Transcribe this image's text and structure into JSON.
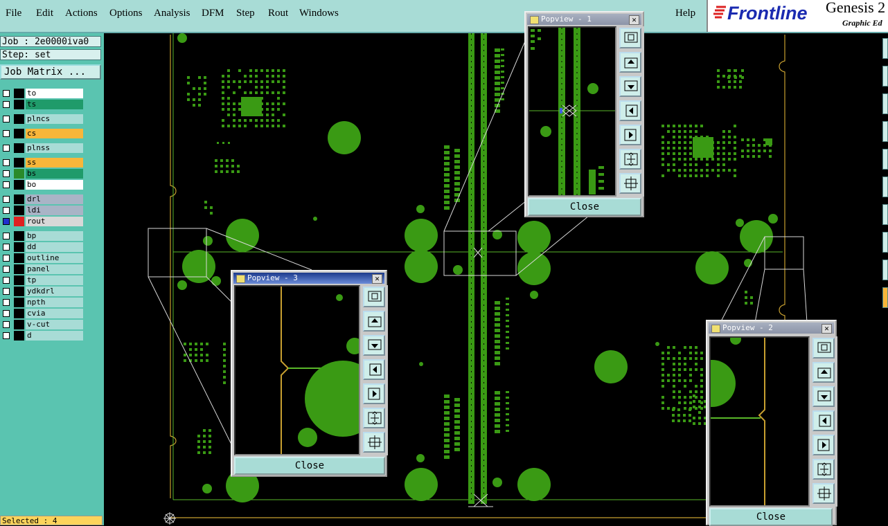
{
  "menu": {
    "file": "File",
    "edit": "Edit",
    "actions": "Actions",
    "options": "Options",
    "analysis": "Analysis",
    "dfm": "DFM",
    "step": "Step",
    "rout": "Rout",
    "windows": "Windows",
    "help": "Help"
  },
  "brand": {
    "logo": "Frontline",
    "title": "Genesis 2",
    "subtitle": "Graphic Ed"
  },
  "job": {
    "job_line": "Job : 2e0000iva0",
    "step_line": "Step: set",
    "matrix_button": "Job Matrix ..."
  },
  "layers": [
    {
      "name": "to",
      "color": "#ffffff",
      "icon_color": "#000000"
    },
    {
      "name": "ts",
      "color": "#1f9b6a",
      "icon_color": "#000000"
    },
    {
      "name": "plncs",
      "color": "#a8dcd6",
      "icon_color": "#000000"
    },
    {
      "name": "cs",
      "color": "#f8b63a",
      "icon_color": "#000000"
    },
    {
      "name": "plnss",
      "color": "#a8dcd6",
      "icon_color": "#000000"
    },
    {
      "name": "ss",
      "color": "#f8b63a",
      "icon_color": "#000000"
    },
    {
      "name": "bs",
      "color": "#1f9b6a",
      "icon_color": "#2a8a2a"
    },
    {
      "name": "bo",
      "color": "#ffffff",
      "icon_color": "#000000"
    },
    {
      "name": "drl",
      "color": "#a9b4c6",
      "icon_color": "#000000"
    },
    {
      "name": "ldi",
      "color": "#a9b4c6",
      "icon_color": "#000000"
    },
    {
      "name": "rout",
      "color": "#d8d8d8",
      "icon_color": "#e02020"
    },
    {
      "name": "bp",
      "color": "#a8dcd6",
      "icon_color": "#000000"
    },
    {
      "name": "dd",
      "color": "#a8dcd6",
      "icon_color": "#000000"
    },
    {
      "name": "outline",
      "color": "#a8dcd6",
      "icon_color": "#000000"
    },
    {
      "name": "panel",
      "color": "#a8dcd6",
      "icon_color": "#000000"
    },
    {
      "name": "tp",
      "color": "#a8dcd6",
      "icon_color": "#000000"
    },
    {
      "name": "ydkdrl",
      "color": "#a8dcd6",
      "icon_color": "#000000"
    },
    {
      "name": "npth",
      "color": "#a8dcd6",
      "icon_color": "#000000"
    },
    {
      "name": "cvia",
      "color": "#a8dcd6",
      "icon_color": "#000000"
    },
    {
      "name": "v-cut",
      "color": "#a8dcd6",
      "icon_color": "#000000"
    },
    {
      "name": "d",
      "color": "#a8dcd6",
      "icon_color": "#000000"
    }
  ],
  "status": {
    "selected": "Selected : 4"
  },
  "popviews": [
    {
      "title": "Popview - 1",
      "close": "Close"
    },
    {
      "title": "Popview - 2",
      "close": "Close"
    },
    {
      "title": "Popview - 3",
      "close": "Close"
    }
  ],
  "colors": {
    "board_bg": "#000000",
    "pad_green": "#3a9a14",
    "route_yellow": "#c8a030",
    "trace_green": "#5ab82a",
    "outline_white": "#d8d8d8"
  },
  "icons": [
    "zoom-fit-icon",
    "pan-up-icon",
    "pan-down-icon",
    "pan-left-icon",
    "pan-right-icon",
    "zoom-in-icon",
    "zoom-out-icon"
  ]
}
